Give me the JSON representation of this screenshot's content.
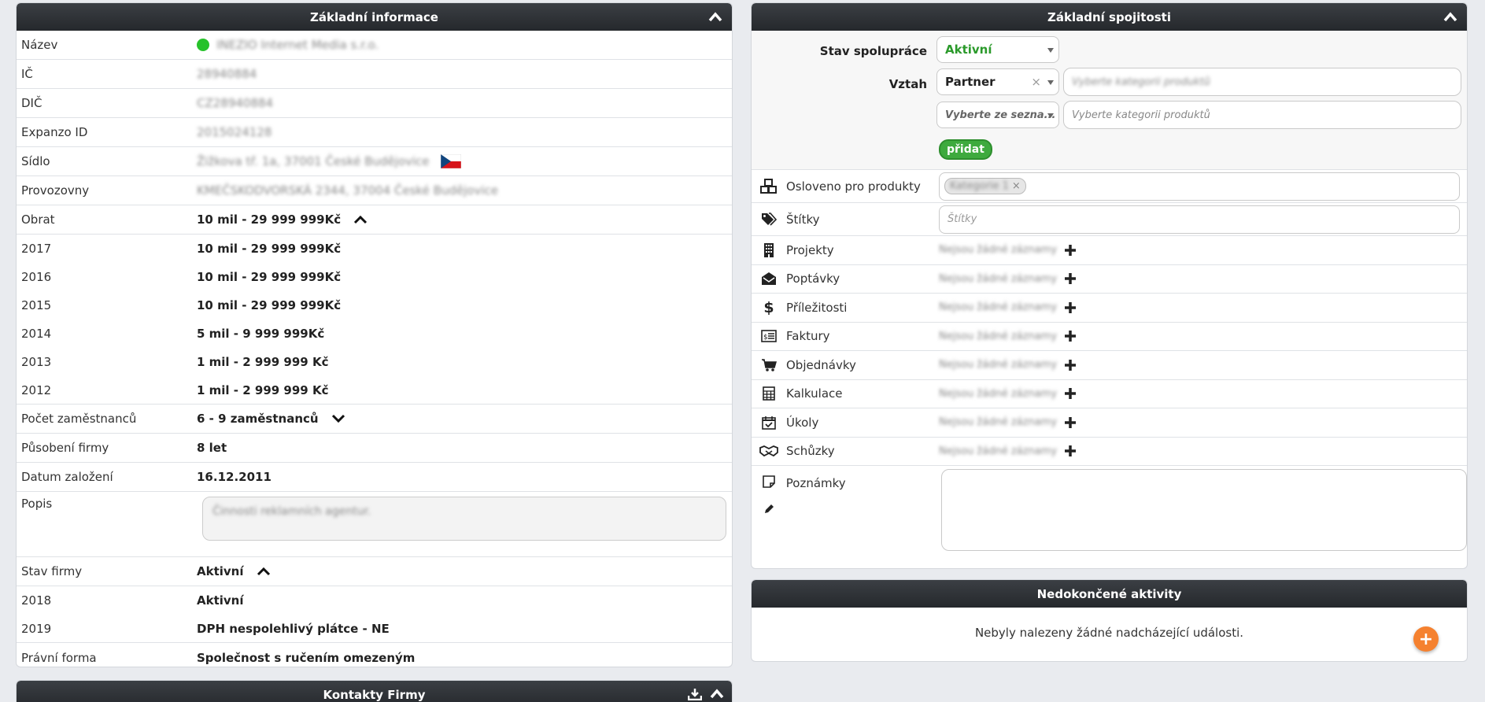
{
  "colors": {
    "header": "#2e3136",
    "accent_green": "#3eaa3e",
    "status_green": "#27c22b",
    "fab_orange": "#f5812f"
  },
  "left": {
    "title": "Základní informace",
    "rows": [
      {
        "label": "Název",
        "value": "INEZIO Internet Media s.r.o.",
        "blurred": true,
        "icon": "status-dot"
      },
      {
        "label": "IČ",
        "value": "28940884",
        "blurred": true
      },
      {
        "label": "DIČ",
        "value": "CZ28940884",
        "blurred": true
      },
      {
        "label": "Expanzo ID",
        "value": "2015024128",
        "blurred": true
      },
      {
        "label": "Sídlo",
        "value": "Žižkova tř. 1a, 37001 České Budějovice",
        "blurred": true,
        "icon": "cz-flag"
      },
      {
        "label": "Provozovny",
        "value": "KMEČSKODVORSKÁ 2344, 37004 České Budějovice",
        "blurred": true
      }
    ],
    "obrat": {
      "label": "Obrat",
      "value": "10 mil - 29 999 999Kč"
    },
    "obrat_history": [
      {
        "year": "2017",
        "value": "10 mil - 29 999 999Kč"
      },
      {
        "year": "2016",
        "value": "10 mil - 29 999 999Kč"
      },
      {
        "year": "2015",
        "value": "10 mil - 29 999 999Kč"
      },
      {
        "year": "2014",
        "value": "5 mil - 9 999 999Kč"
      },
      {
        "year": "2013",
        "value": "1 mil - 2 999 999 Kč"
      },
      {
        "year": "2012",
        "value": "1 mil - 2 999 999 Kč"
      }
    ],
    "zamestnanci": {
      "label": "Počet zaměstnanců",
      "value": "6 - 9 zaměstnanců"
    },
    "pusobeni": {
      "label": "Působení firmy",
      "value": "8 let"
    },
    "zalozeni": {
      "label": "Datum založení",
      "value": "16.12.2011"
    },
    "popis": {
      "label": "Popis",
      "value": "Činnosti reklamních agentur."
    },
    "stav": {
      "label": "Stav firmy",
      "value": "Aktivní"
    },
    "stav_history": [
      {
        "year": "2018",
        "value": "Aktivní"
      },
      {
        "year": "2019",
        "value": "DPH nespolehlivý plátce - NE"
      }
    ],
    "pravni": {
      "label": "Právní forma",
      "value": "Společnost s ručením omezeným"
    }
  },
  "kontakty": {
    "title": "Kontakty Firmy"
  },
  "right": {
    "title": "Základní spojitosti",
    "stav_spoluprace": {
      "label": "Stav spolupráce",
      "value": "Aktivní"
    },
    "vztah": {
      "label": "Vztah",
      "value": "Partner",
      "clear": "×",
      "category_value": "Vyberte kategorii produktů"
    },
    "second_select": {
      "placeholder": "Vyberte ze sezna...",
      "category_placeholder": "Vyberte kategorii produktů"
    },
    "add_button": "přidat",
    "osloveno": {
      "label": "Osloveno pro produkty",
      "chip": "Kategorie 1",
      "chip_remove": "×"
    },
    "stitky": {
      "label": "Štítky",
      "placeholder": "Štítky"
    },
    "empty_text": "Nejsou žádné záznamy",
    "items": [
      {
        "label": "Projekty",
        "icon": "building-icon"
      },
      {
        "label": "Poptávky",
        "icon": "envelope-icon"
      },
      {
        "label": "Příležitosti",
        "icon": "dollar-icon"
      },
      {
        "label": "Faktury",
        "icon": "invoice-icon"
      },
      {
        "label": "Objednávky",
        "icon": "cart-icon"
      },
      {
        "label": "Kalkulace",
        "icon": "calculator-icon"
      },
      {
        "label": "Úkoly",
        "icon": "calendar-check-icon"
      },
      {
        "label": "Schůzky",
        "icon": "handshake-icon"
      }
    ],
    "poznamky": {
      "label": "Poznámky"
    }
  },
  "activities": {
    "title": "Nedokončené aktivity",
    "empty": "Nebyly nalezeny žádné nadcházející události.",
    "fab": "+"
  }
}
